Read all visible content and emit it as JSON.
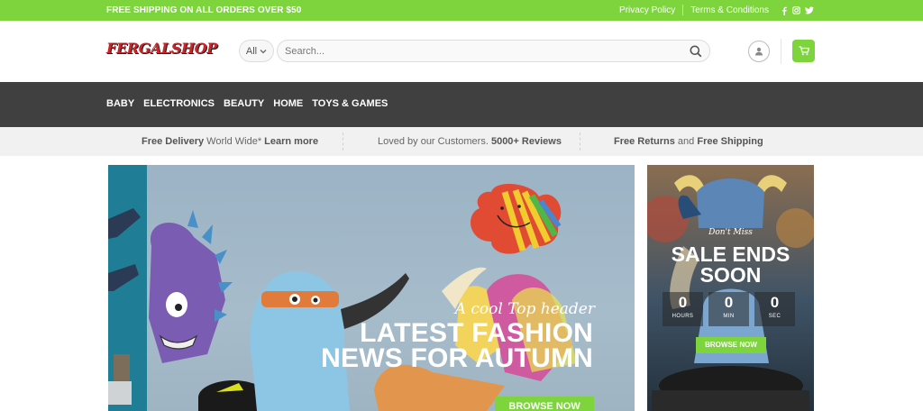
{
  "topbar": {
    "promo": "FREE SHIPPING ON ALL ORDERS OVER $50",
    "links": [
      "Privacy Policy",
      "Terms & Conditions"
    ],
    "social": [
      "facebook-icon",
      "instagram-icon",
      "twitter-icon"
    ]
  },
  "header": {
    "logo": "FERGALSHOP",
    "category": "All",
    "search_placeholder": "Search..."
  },
  "nav": {
    "items": [
      "BABY",
      "ELECTRONICS",
      "BEAUTY",
      "HOME",
      "TOYS & GAMES"
    ]
  },
  "features": {
    "delivery_bold": "Free Delivery",
    "delivery_rest": "World Wide*",
    "delivery_link": "Learn more",
    "reviews_pre": "Loved by our Customers.",
    "reviews_bold": "5000+ Reviews",
    "returns_a": "Free Returns",
    "returns_and": "and",
    "returns_b": "Free Shipping"
  },
  "hero": {
    "kicker": "A cool Top header",
    "headline_line1": "LATEST FASHION",
    "headline_line2": "NEWS FOR AUTUMN",
    "button": "BROWSE NOW"
  },
  "sale": {
    "kicker": "Don't Miss",
    "title_line1": "SALE ENDS",
    "title_line2": "SOON",
    "countdown": [
      {
        "value": "0",
        "unit": "HOURS"
      },
      {
        "value": "0",
        "unit": "MIN"
      },
      {
        "value": "0",
        "unit": "SEC"
      }
    ],
    "button": "BROWSE NOW"
  },
  "colors": {
    "accent": "#7ed43d",
    "nav_bg": "#404040",
    "logo_red": "#c8262b"
  }
}
